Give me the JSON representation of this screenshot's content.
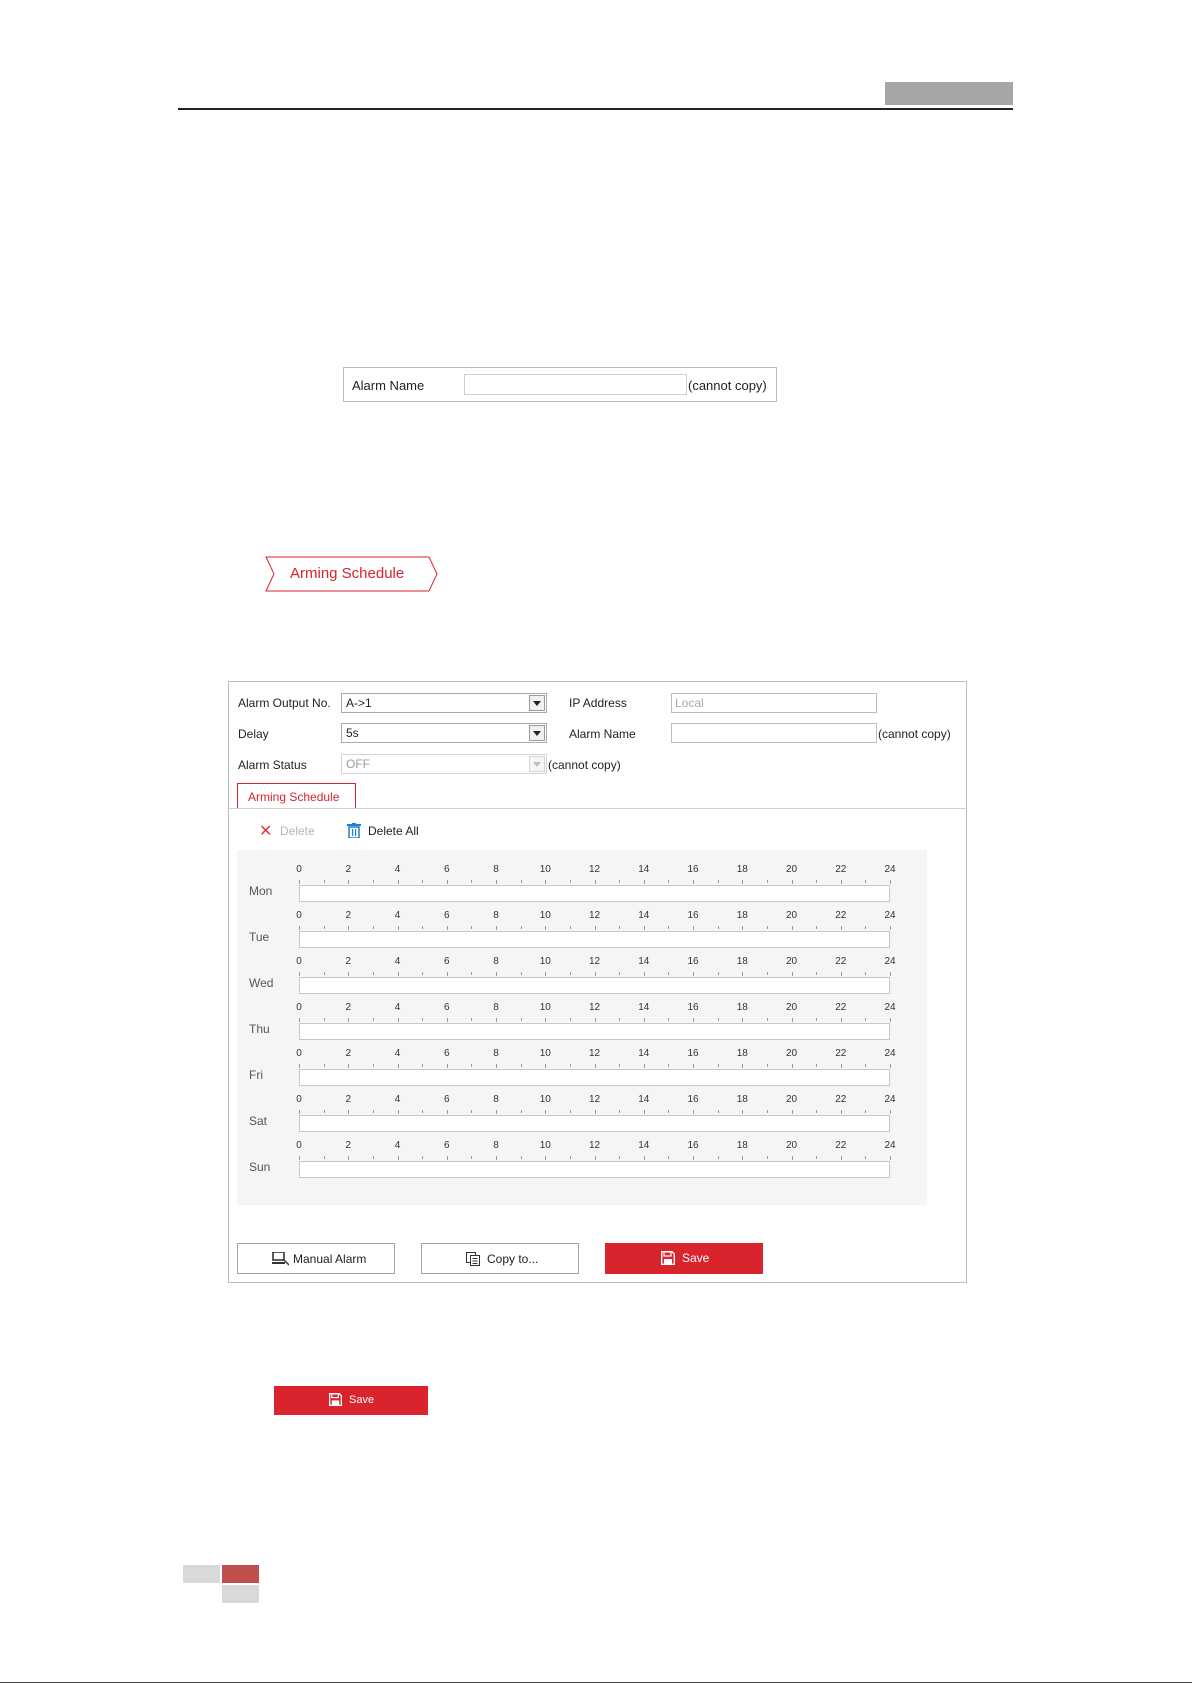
{
  "small_form": {
    "alarm_name_label": "Alarm Name",
    "alarm_name_value": "",
    "cannot_copy": "(cannot copy)"
  },
  "arming_tag": {
    "label": "Arming Schedule"
  },
  "panel": {
    "alarm_output_label": "Alarm Output No.",
    "alarm_output_value": "A->1",
    "ip_label": "IP Address",
    "ip_placeholder": "Local",
    "delay_label": "Delay",
    "delay_value": "5s",
    "alarm_name_label": "Alarm Name",
    "alarm_name_value": "",
    "alarm_name_note": "(cannot copy)",
    "alarm_status_label": "Alarm Status",
    "alarm_status_value": "OFF",
    "alarm_status_note": "(cannot copy)",
    "tab_label": "Arming Schedule",
    "delete_label": "Delete",
    "delete_all_label": "Delete All",
    "hours": [
      "0",
      "2",
      "4",
      "6",
      "8",
      "10",
      "12",
      "14",
      "16",
      "18",
      "20",
      "22",
      "24"
    ],
    "days": [
      "Mon",
      "Tue",
      "Wed",
      "Thu",
      "Fri",
      "Sat",
      "Sun"
    ],
    "manual_alarm_label": "Manual Alarm",
    "copy_to_label": "Copy to...",
    "save_label": "Save"
  },
  "standalone_save": {
    "label": "Save"
  },
  "colors": {
    "accent": "#d9232d",
    "footer_red": "#c0504d",
    "footer_gray": "#d9d9d9",
    "header_gray": "#a6a6a6"
  },
  "icons": {
    "delete": "close-icon",
    "delete_all": "trash-icon",
    "manual_alarm": "manual-alarm-icon",
    "copy_to": "copy-icon",
    "save": "save-icon"
  }
}
